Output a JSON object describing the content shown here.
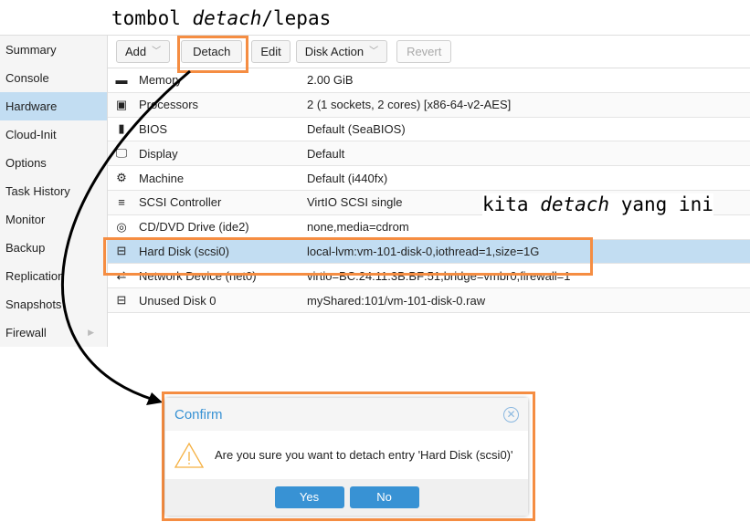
{
  "annotations": {
    "top_prefix": "tombol ",
    "top_italic": "detach",
    "top_suffix": "/lepas",
    "right_prefix": "kita ",
    "right_italic": "detach",
    "right_suffix": " yang ini"
  },
  "sidebar": {
    "items": [
      {
        "label": "Summary"
      },
      {
        "label": "Console"
      },
      {
        "label": "Hardware",
        "active": true
      },
      {
        "label": "Cloud-Init"
      },
      {
        "label": "Options"
      },
      {
        "label": "Task History"
      },
      {
        "label": "Monitor"
      },
      {
        "label": "Backup"
      },
      {
        "label": "Replication"
      },
      {
        "label": "Snapshots"
      },
      {
        "label": "Firewall"
      }
    ]
  },
  "toolbar": {
    "add": "Add",
    "detach": "Detach",
    "edit": "Edit",
    "disk_action": "Disk Action",
    "revert": "Revert"
  },
  "hardware": [
    {
      "icon": "memory-icon",
      "glyph": "▬",
      "name": "Memory",
      "value": "2.00 GiB"
    },
    {
      "icon": "cpu-icon",
      "glyph": "▣",
      "name": "Processors",
      "value": "2 (1 sockets, 2 cores) [x86-64-v2-AES]"
    },
    {
      "icon": "bios-chip-icon",
      "glyph": "▮",
      "name": "BIOS",
      "value": "Default (SeaBIOS)"
    },
    {
      "icon": "monitor-icon",
      "glyph": "🖵",
      "name": "Display",
      "value": "Default"
    },
    {
      "icon": "gears-icon",
      "glyph": "⚙",
      "name": "Machine",
      "value": "Default (i440fx)"
    },
    {
      "icon": "database-icon",
      "glyph": "≡",
      "name": "SCSI Controller",
      "value": "VirtIO SCSI single"
    },
    {
      "icon": "cdrom-icon",
      "glyph": "◎",
      "name": "CD/DVD Drive (ide2)",
      "value": "none,media=cdrom"
    },
    {
      "icon": "hdd-icon",
      "glyph": "⊟",
      "name": "Hard Disk (scsi0)",
      "value": "local-lvm:vm-101-disk-0,iothread=1,size=1G",
      "selected": true
    },
    {
      "icon": "network-icon",
      "glyph": "⇄",
      "name": "Network Device (net0)",
      "value": "virtio=BC:24:11:3B:BF:51,bridge=vmbr0,firewall=1"
    },
    {
      "icon": "hdd-icon",
      "glyph": "⊟",
      "name": "Unused Disk 0",
      "value": "myShared:101/vm-101-disk-0.raw"
    }
  ],
  "dialog": {
    "title": "Confirm",
    "message": "Are you sure you want to detach entry 'Hard Disk (scsi0)'",
    "yes": "Yes",
    "no": "No"
  },
  "colors": {
    "highlight": "#f58d42",
    "accent": "#3892d4",
    "selected_row": "#c2ddf2"
  }
}
